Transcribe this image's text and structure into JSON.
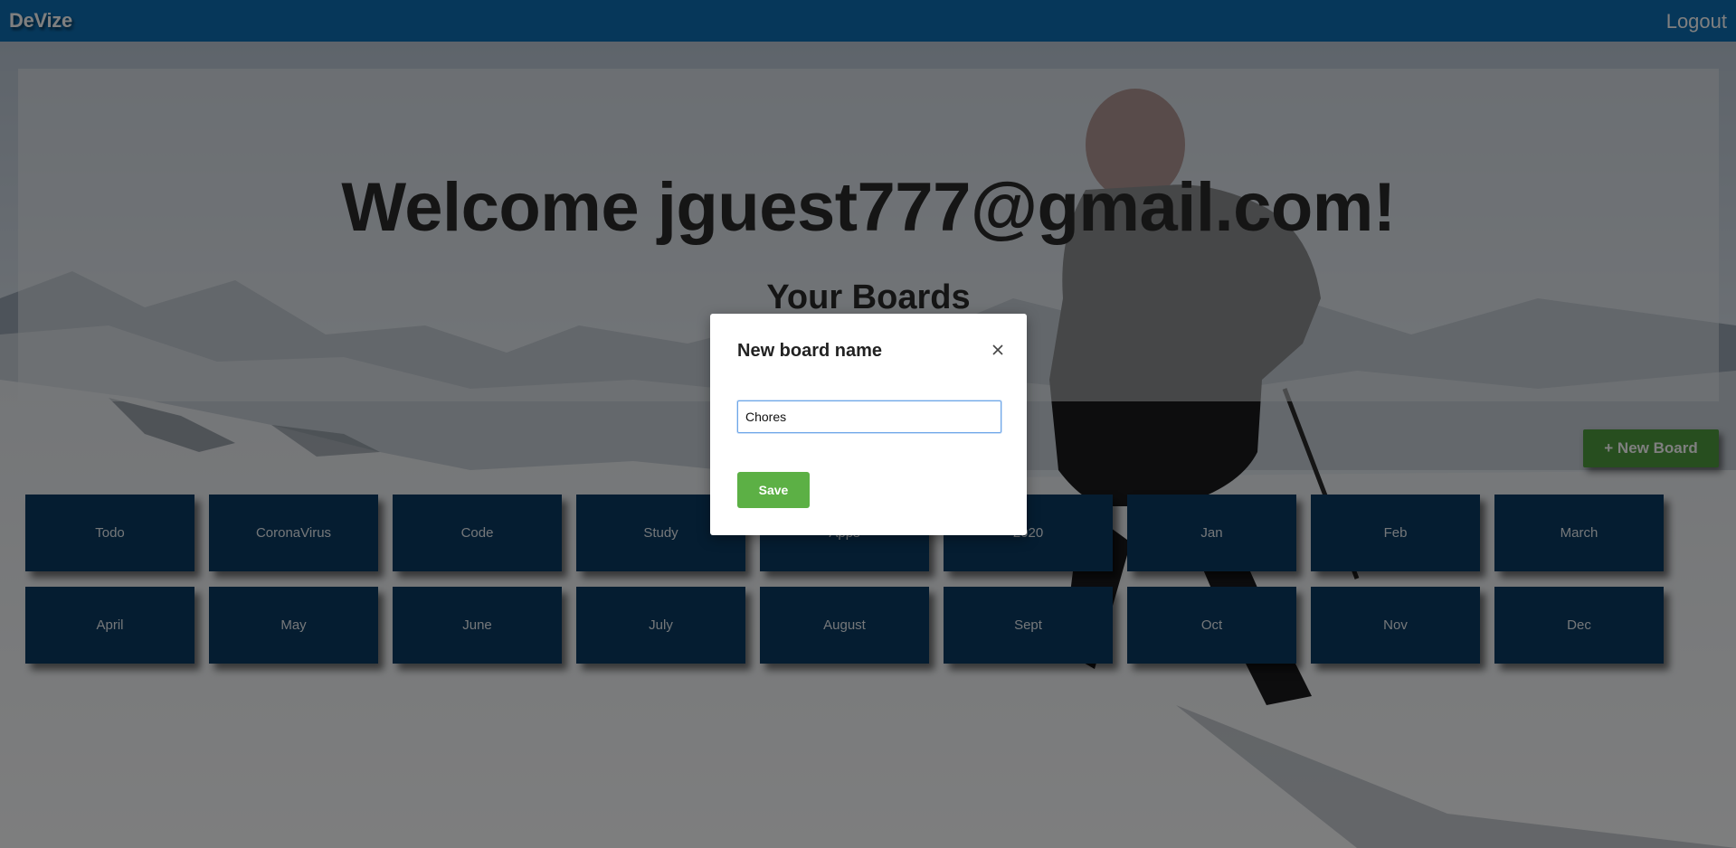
{
  "navbar": {
    "brand": "DeVize",
    "logout_label": "Logout"
  },
  "header": {
    "welcome_text": "Welcome jguest777@gmail.com!",
    "boards_heading": "Your Boards"
  },
  "actions": {
    "new_board_label": "+ New Board"
  },
  "boards": [
    "Todo",
    "CoronaVirus",
    "Code",
    "Study",
    "Apps",
    "2020",
    "Jan",
    "Feb",
    "March",
    "April",
    "May",
    "June",
    "July",
    "August",
    "Sept",
    "Oct",
    "Nov",
    "Dec"
  ],
  "modal": {
    "title": "New board name",
    "input_value": "Chores",
    "save_label": "Save",
    "close_icon": "close-icon"
  },
  "colors": {
    "navbar": "#0d6fb5",
    "board_card": "#0a3a63",
    "new_board_button": "#4e9d3f",
    "save_button": "#5cb045"
  }
}
